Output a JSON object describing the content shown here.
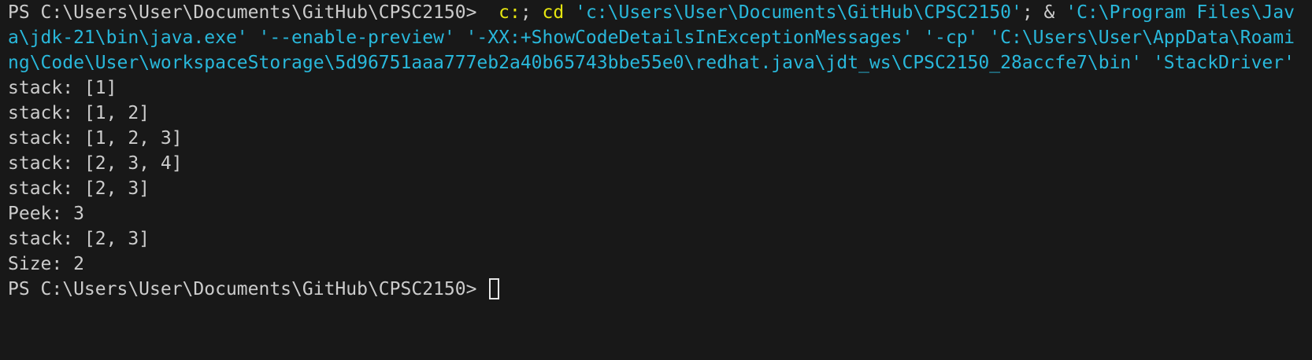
{
  "terminal": {
    "command": {
      "prompt": "PS C:\\Users\\User\\Documents\\GitHub\\CPSC2150>",
      "tokens": [
        {
          "text": "c:",
          "color": "#e5e510"
        },
        {
          "text": "; ",
          "color": "#cccccc"
        },
        {
          "text": "cd",
          "color": "#e5e510"
        },
        {
          "text": " ",
          "color": "#cccccc"
        },
        {
          "text": "'c:\\Users\\User\\Documents\\GitHub\\CPSC2150'",
          "color": "#29b8db"
        },
        {
          "text": "; & ",
          "color": "#cccccc"
        },
        {
          "text": "'C:\\Program Files\\Java\\jdk-21\\bin\\java.exe' '--enable-preview' '-XX:+ShowCodeDetailsInExceptionMessages' '-cp' 'C:\\Users\\User\\AppData\\Roaming\\Code\\User\\workspaceStorage\\5d96751aaa777eb2a40b65743bbe55e0\\redhat.java\\jdt_ws\\CPSC2150_28accfe7\\bin' 'StackDriver'",
          "color": "#29b8db"
        }
      ]
    },
    "output_lines": [
      "stack: [1]",
      "stack: [1, 2]",
      "stack: [1, 2, 3]",
      "stack: [2, 3, 4]",
      "stack: [2, 3]",
      "Peek: 3",
      "stack: [2, 3]",
      "Size: 2"
    ],
    "final_prompt": "PS C:\\Users\\User\\Documents\\GitHub\\CPSC2150>"
  }
}
